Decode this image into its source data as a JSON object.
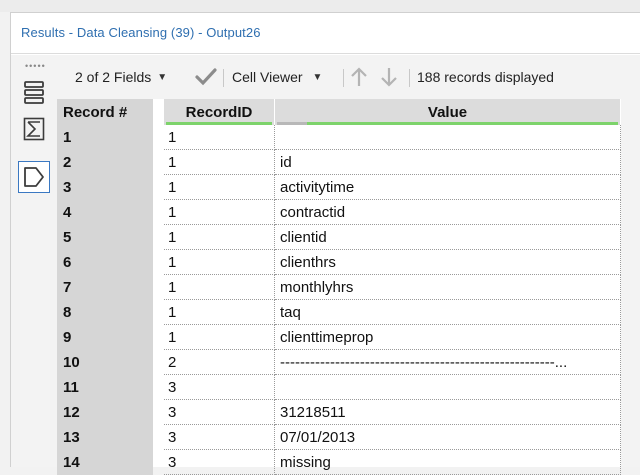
{
  "results": {
    "title": "Results - Data Cleansing (39) - Output26"
  },
  "sidebar": {
    "grip": "•••••",
    "buttons": [
      {
        "icon": "data-rows-icon"
      },
      {
        "icon": "summation-icon"
      },
      {
        "icon": "tag-icon",
        "selected": true
      }
    ]
  },
  "toolbar": {
    "fields_label": "2 of 2 Fields",
    "viewer_label": "Cell Viewer",
    "records_text": "188 records displayed"
  },
  "table": {
    "record_header": "Record #",
    "columns": [
      "RecordID",
      "Value"
    ],
    "rows": [
      {
        "rec": "1",
        "recordid": "1",
        "value": ""
      },
      {
        "rec": "2",
        "recordid": "1",
        "value": "id"
      },
      {
        "rec": "3",
        "recordid": "1",
        "value": "activitytime"
      },
      {
        "rec": "4",
        "recordid": "1",
        "value": "contractid"
      },
      {
        "rec": "5",
        "recordid": "1",
        "value": "clientid"
      },
      {
        "rec": "6",
        "recordid": "1",
        "value": "clienthrs"
      },
      {
        "rec": "7",
        "recordid": "1",
        "value": "monthlyhrs"
      },
      {
        "rec": "8",
        "recordid": "1",
        "value": "taq"
      },
      {
        "rec": "9",
        "recordid": "1",
        "value": "clienttimeprop"
      },
      {
        "rec": "10",
        "recordid": "2",
        "value": "-------------------------------------------------------..."
      },
      {
        "rec": "11",
        "recordid": "3",
        "value": ""
      },
      {
        "rec": "12",
        "recordid": "3",
        "value": "31218511"
      },
      {
        "rec": "13",
        "recordid": "3",
        "value": "07/01/2013"
      },
      {
        "rec": "14",
        "recordid": "3",
        "value": "missing"
      }
    ]
  },
  "colors": {
    "accent": "#2f6fb0",
    "header_underline": "#7dd36b"
  }
}
